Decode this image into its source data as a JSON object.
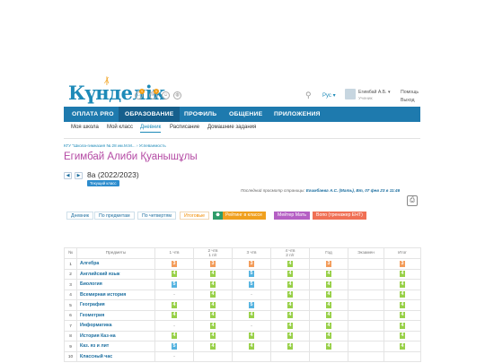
{
  "header": {
    "logo_text": "Күнделік",
    "badge_count_1": "1",
    "badge_count_2": "1",
    "lang": "Рус",
    "user_name": "Егимбай А.Б.",
    "user_role": "Ученик",
    "help": "Помощь",
    "logout": "Выход"
  },
  "nav": {
    "items": [
      "ОПЛАТА PRO",
      "ОБРАЗОВАНИЕ",
      "ПРОФИЛЬ",
      "ОБЩЕНИЕ",
      "ПРИЛОЖЕНИЯ"
    ],
    "active_index": 1
  },
  "subnav": {
    "items": [
      "Моя школа",
      "Мой класс",
      "Дневник",
      "Расписание",
      "Домашние задания"
    ],
    "active_index": 2
  },
  "breadcrumb": {
    "school": "КГУ \"Школа-гимназия № 28 им.М.М... ",
    "sep": "›",
    "page": "Успеваемость"
  },
  "student": {
    "name": "Егимбай Алиби Қуанышұлы",
    "class": "8а (2022/2023)",
    "current_badge": "Текущий класс"
  },
  "last_view": {
    "prefix": "Последний просмотр страницы: ",
    "who": "Егимбаева А.С. (Мать), Вт, 07 фев 23 в 11:46"
  },
  "tabs": [
    "Дневник",
    "По предметам",
    "По четвертям",
    "Итоговые",
    "Рейтинг в классе",
    "Мейтер Мать",
    "Вопо (тренажер ЕНТ)"
  ],
  "tab_colors": {
    "rating": "#f0a01e",
    "meiter": "#b55fc4",
    "vopo": "#f07055",
    "rating_icon": "#2e9c6a"
  },
  "table": {
    "headers": [
      "№",
      "Предметы",
      "1 чтв",
      "2 чтв\n1 п/г",
      "3 чтв",
      "4 чтв\n2 п/г",
      "Год",
      "Экзамен",
      "Итог"
    ],
    "rows": [
      {
        "n": "1",
        "subject": "Алгебра",
        "g": [
          "3",
          "3",
          "3",
          "4",
          "3",
          "",
          "3"
        ]
      },
      {
        "n": "2",
        "subject": "Английский язык",
        "g": [
          "4",
          "4",
          "5",
          "4",
          "4",
          "",
          "4"
        ]
      },
      {
        "n": "3",
        "subject": "Биология",
        "g": [
          "5",
          "4",
          "5",
          "4",
          "4",
          "",
          "4"
        ]
      },
      {
        "n": "4",
        "subject": "Всемирная история",
        "g": [
          "-",
          "4",
          "-",
          "4",
          "4",
          "",
          "4"
        ]
      },
      {
        "n": "5",
        "subject": "География",
        "g": [
          "4",
          "4",
          "5",
          "4",
          "4",
          "",
          "4"
        ]
      },
      {
        "n": "6",
        "subject": "Геометрия",
        "g": [
          "4",
          "4",
          "4",
          "4",
          "4",
          "",
          "4"
        ]
      },
      {
        "n": "7",
        "subject": "Информатика",
        "g": [
          "-",
          "4",
          "-",
          "4",
          "4",
          "",
          "4"
        ]
      },
      {
        "n": "8",
        "subject": "История Каз-на",
        "g": [
          "4",
          "4",
          "4",
          "4",
          "4",
          "",
          "4"
        ]
      },
      {
        "n": "9",
        "subject": "Каз. яз и лит",
        "g": [
          "5",
          "4",
          "4",
          "4",
          "4",
          "",
          "4"
        ]
      },
      {
        "n": "10",
        "subject": "Классный час",
        "g": [
          "-",
          "",
          "",
          "",
          "",
          "",
          ""
        ]
      }
    ]
  }
}
